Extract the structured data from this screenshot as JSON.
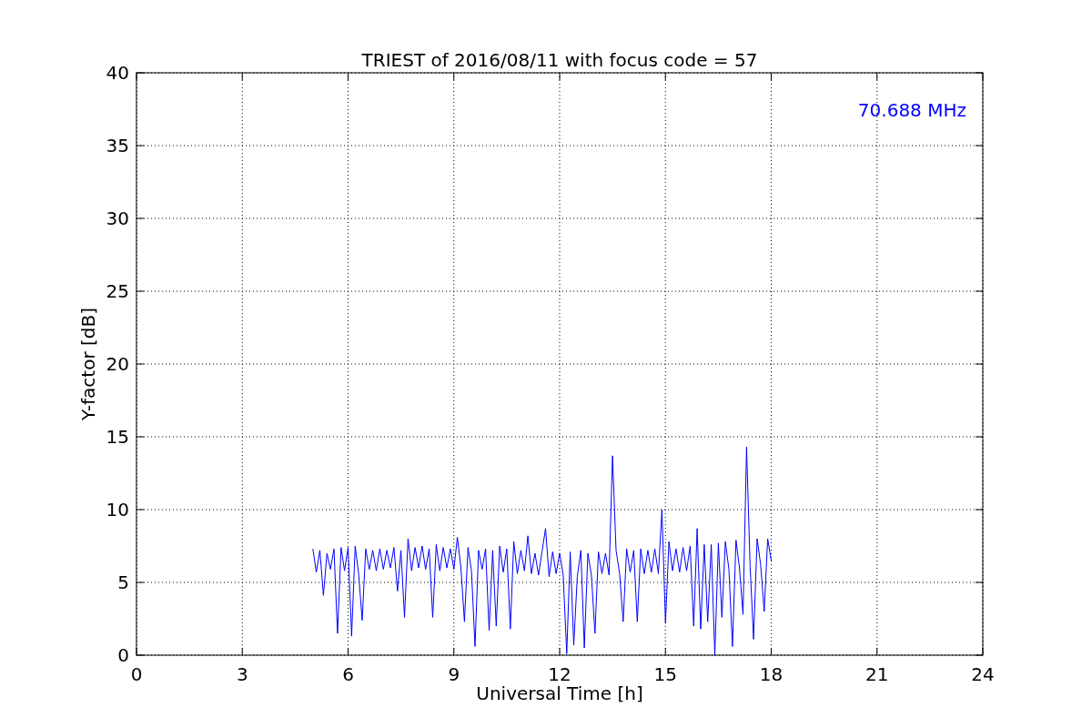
{
  "chart_data": {
    "type": "line",
    "title": "TRIEST of 2016/08/11 with focus code = 57",
    "xlabel": "Universal Time [h]",
    "ylabel": "Y-factor [dB]",
    "xlim": [
      0,
      24
    ],
    "ylim": [
      0,
      40
    ],
    "grid": true,
    "xticks": [
      0,
      3,
      6,
      9,
      12,
      15,
      18,
      21,
      24
    ],
    "yticks": [
      0,
      5,
      10,
      15,
      20,
      25,
      30,
      35,
      40
    ],
    "x": [
      5.0,
      5.1,
      5.2,
      5.3,
      5.4,
      5.5,
      5.6,
      5.7,
      5.8,
      5.9,
      6.0,
      6.1,
      6.2,
      6.3,
      6.4,
      6.5,
      6.6,
      6.7,
      6.8,
      6.9,
      7.0,
      7.1,
      7.2,
      7.3,
      7.4,
      7.5,
      7.6,
      7.7,
      7.8,
      7.9,
      8.0,
      8.1,
      8.2,
      8.3,
      8.4,
      8.5,
      8.6,
      8.7,
      8.8,
      8.9,
      9.0,
      9.1,
      9.2,
      9.3,
      9.4,
      9.5,
      9.6,
      9.7,
      9.8,
      9.9,
      10.0,
      10.1,
      10.2,
      10.3,
      10.4,
      10.5,
      10.6,
      10.7,
      10.8,
      10.9,
      11.0,
      11.1,
      11.2,
      11.3,
      11.4,
      11.5,
      11.6,
      11.7,
      11.8,
      11.9,
      12.0,
      12.1,
      12.2,
      12.3,
      12.4,
      12.5,
      12.6,
      12.7,
      12.8,
      12.9,
      13.0,
      13.1,
      13.2,
      13.3,
      13.4,
      13.5,
      13.6,
      13.7,
      13.8,
      13.9,
      14.0,
      14.1,
      14.2,
      14.3,
      14.4,
      14.5,
      14.6,
      14.7,
      14.8,
      14.9,
      15.0,
      15.1,
      15.2,
      15.3,
      15.4,
      15.5,
      15.6,
      15.7,
      15.8,
      15.9,
      16.0,
      16.1,
      16.2,
      16.3,
      16.4,
      16.5,
      16.6,
      16.7,
      16.8,
      16.9,
      17.0,
      17.1,
      17.2,
      17.3,
      17.4,
      17.5,
      17.6,
      17.7,
      17.8,
      17.9,
      18.0
    ],
    "series": [
      {
        "name": "70.688 MHz",
        "color": "#0000ff",
        "values": [
          7.3,
          5.7,
          7.2,
          4.1,
          7.0,
          5.9,
          7.3,
          1.5,
          7.4,
          5.8,
          7.4,
          1.3,
          7.5,
          5.6,
          2.4,
          7.3,
          5.9,
          7.2,
          5.8,
          7.3,
          5.9,
          7.2,
          6.0,
          7.4,
          4.4,
          7.2,
          2.6,
          8.0,
          5.8,
          7.4,
          6.0,
          7.5,
          5.9,
          7.3,
          2.6,
          7.6,
          5.8,
          7.4,
          6.0,
          7.3,
          5.9,
          8.1,
          6.0,
          2.3,
          7.4,
          5.8,
          0.6,
          7.2,
          5.9,
          7.3,
          1.7,
          7.2,
          2.0,
          7.5,
          5.7,
          7.3,
          1.8,
          7.8,
          5.6,
          7.2,
          5.8,
          8.2,
          5.6,
          7.0,
          5.5,
          7.1,
          8.7,
          5.4,
          7.1,
          5.6,
          7.0,
          5.5,
          0.1,
          7.1,
          0.7,
          5.4,
          7.2,
          0.5,
          7.0,
          5.5,
          1.5,
          7.1,
          5.6,
          7.0,
          5.5,
          13.7,
          7.2,
          5.6,
          2.3,
          7.3,
          5.7,
          7.2,
          2.3,
          7.3,
          5.6,
          7.2,
          5.7,
          7.3,
          5.6,
          10.0,
          2.2,
          7.8,
          5.8,
          7.3,
          5.7,
          7.4,
          5.8,
          7.5,
          2.0,
          8.7,
          1.8,
          7.6,
          2.3,
          7.6,
          0.0,
          7.7,
          2.6,
          7.8,
          5.9,
          0.6,
          7.9,
          6.0,
          2.8,
          14.3,
          6.1,
          1.1,
          8.0,
          6.2,
          3.0,
          8.0,
          6.5
        ]
      }
    ]
  }
}
